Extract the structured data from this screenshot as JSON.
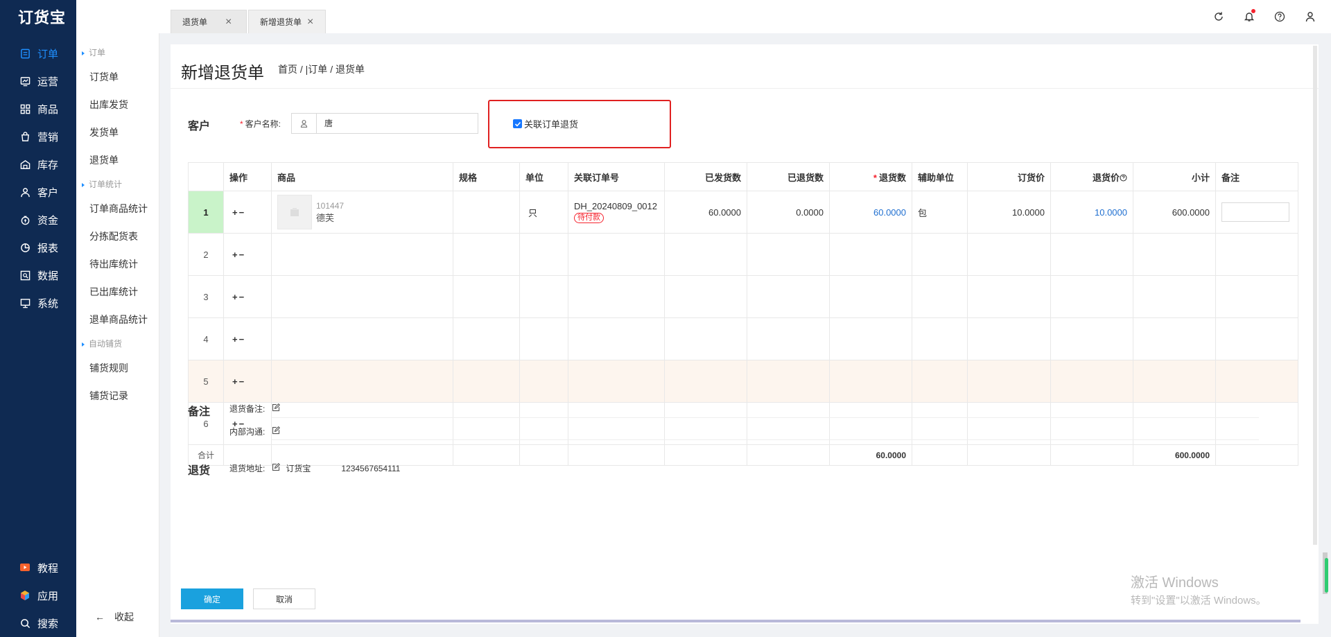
{
  "app": {
    "logo": "订货宝"
  },
  "nav": {
    "items": [
      {
        "label": "订单",
        "icon": "order-icon",
        "active": true
      },
      {
        "label": "运营",
        "icon": "operation-icon"
      },
      {
        "label": "商品",
        "icon": "product-icon"
      },
      {
        "label": "营销",
        "icon": "marketing-icon"
      },
      {
        "label": "库存",
        "icon": "inventory-icon"
      },
      {
        "label": "客户",
        "icon": "customer-icon"
      },
      {
        "label": "资金",
        "icon": "funds-icon"
      },
      {
        "label": "报表",
        "icon": "report-icon"
      },
      {
        "label": "数据",
        "icon": "data-icon"
      },
      {
        "label": "系统",
        "icon": "system-icon"
      }
    ],
    "bottom": [
      {
        "label": "教程",
        "icon": "tutorial-icon"
      },
      {
        "label": "应用",
        "icon": "apps-icon"
      },
      {
        "label": "搜索",
        "icon": "search-icon"
      }
    ],
    "accent_color": "#1f8fff",
    "bg_color": "#0f2a52"
  },
  "subnav": {
    "group1": "订单",
    "group1_items": [
      "订货单",
      "出库发货",
      "发货单",
      "退货单"
    ],
    "group2": "订单统计",
    "group2_items": [
      "订单商品统计",
      "分拣配货表",
      "待出库统计",
      "已出库统计",
      "退单商品统计"
    ],
    "group3": "自动铺货",
    "group3_items": [
      "铺货规则",
      "铺货记录"
    ],
    "collapse": "收起"
  },
  "tabs": [
    {
      "label": "退货单"
    },
    {
      "label": "新增退货单"
    }
  ],
  "page": {
    "title": "新增退货单",
    "breadcrumb": "首页 / |订单 / 退货单"
  },
  "customer": {
    "section": "客户",
    "label": "客户名称:",
    "value": "唐",
    "link_order_label": "关联订单退货",
    "link_order_checked": true
  },
  "table": {
    "headers": [
      "操作",
      "商品",
      "规格",
      "单位",
      "关联订单号",
      "已发货数",
      "已退货数",
      "退货数",
      "辅助单位",
      "订货价",
      "退货价",
      "小计",
      "备注"
    ],
    "row1": {
      "index": "1",
      "ops": "+−",
      "product_code": "101447",
      "product_name": "德芙",
      "spec": "",
      "unit": "只",
      "order_no": "DH_20240809_0012",
      "order_status": "待付款",
      "shipped": "60.0000",
      "returned": "0.0000",
      "return_qty": "60.0000",
      "aux_unit": "包",
      "order_price": "10.0000",
      "return_price": "10.0000",
      "subtotal": "600.0000"
    },
    "empty_rows": [
      "2",
      "3",
      "4",
      "5",
      "6"
    ],
    "ops": "+−",
    "total_label": "合计",
    "total_return_qty": "60.0000",
    "total_subtotal": "600.0000"
  },
  "remarks": {
    "section": "备注",
    "return_remark": "退货备注:",
    "internal": "内部沟通:"
  },
  "return_info": {
    "section": "退货",
    "address_label": "退货地址:",
    "address_name": "订货宝",
    "phone": "1234567654111"
  },
  "buttons": {
    "ok": "确定",
    "cancel": "取消"
  },
  "watermark": {
    "line1": "激活 Windows",
    "line2": "转到\"设置\"以激活 Windows。"
  }
}
